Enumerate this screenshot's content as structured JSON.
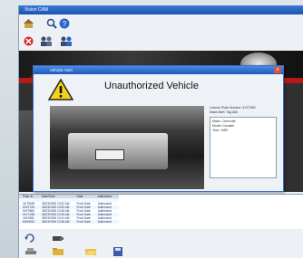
{
  "window": {
    "title": "Vision CAM"
  },
  "toolbar1": {
    "icons": [
      "home-icon",
      "search-icon",
      "help-icon"
    ]
  },
  "toolbar2": {
    "icons": [
      "stop-icon",
      "users-icon",
      "users-add-icon"
    ]
  },
  "dialog": {
    "title": "Vehicle Alert",
    "heading": "Unauthorized Vehicle",
    "fields": [
      "License Plate Number: 5YZ7890",
      "Make Alert: Tag A86"
    ],
    "details": [
      "Make: Chevrolet",
      "Model: Cavalier",
      "Year: 1985"
    ],
    "close_label": "x"
  },
  "grid": {
    "headers": [
      "Plate ID",
      "Date/Time",
      "Gate",
      "Authorized"
    ],
    "rows": [
      [
        "5YZ7890",
        "08/23/2006 10:55 AM",
        "Front Gate",
        "Unauthorized"
      ],
      [
        "4UT5483",
        "08/23/2006 10:52 AM",
        "Front Gate",
        "Authorized"
      ],
      [
        "6ZKT234",
        "08/23/2006 10:50 AM",
        "Front Gate",
        "Authorized"
      ],
      [
        "5VF3984",
        "08/23/2006 10:48 AM",
        "Front Gate",
        "Authorized"
      ],
      [
        "3XY1298",
        "08/23/2006 10:45 AM",
        "Front Gate",
        "Authorized"
      ],
      [
        "2KL9381",
        "08/23/2006 10:41 AM",
        "Front Gate",
        "Authorized"
      ],
      [
        "8JM4532",
        "08/23/2006 10:38 AM",
        "Front Gate",
        "Authorized"
      ]
    ]
  },
  "colors": {
    "titlebar": "#1c52b0",
    "accent_red": "#b51a1a",
    "selection": "#2e6bd0"
  }
}
